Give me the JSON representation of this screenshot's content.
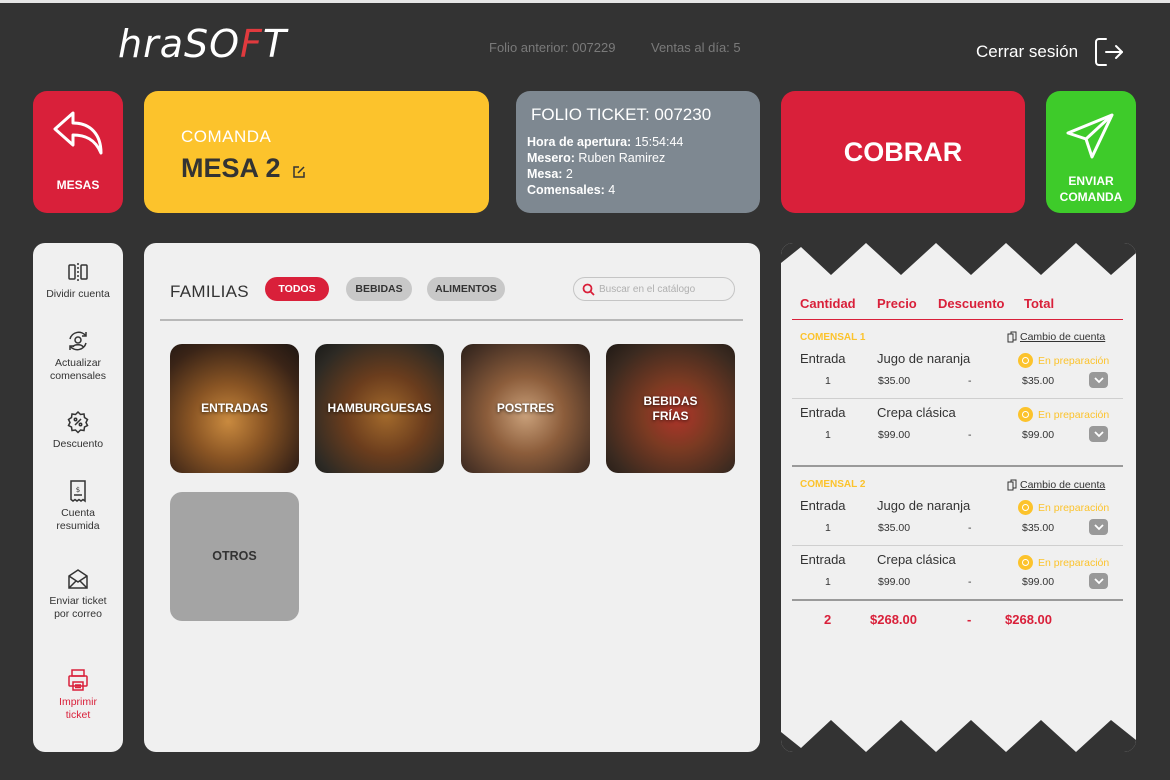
{
  "header": {
    "logo_prefix": "hraSO",
    "logo_accent": "F",
    "logo_suffix": "T",
    "folio_anterior": "Folio anterior: 007229",
    "ventas_dia": "Ventas al día: 5",
    "logout_label": "Cerrar sesión"
  },
  "cards": {
    "mesas_label": "MESAS",
    "comanda_caption": "COMANDA",
    "mesa_title": "MESA 2",
    "ticket": {
      "title": "FOLIO TICKET: 007230",
      "hora_label": "Hora de apertura:",
      "hora_value": "15:54:44",
      "mesero_label": "Mesero:",
      "mesero_value": "Ruben Ramirez",
      "mesa_label": "Mesa:",
      "mesa_value": "2",
      "comensales_label": "Comensales:",
      "comensales_value": "4"
    },
    "cobrar_label": "COBRAR",
    "enviar_line1": "ENVIAR",
    "enviar_line2": "COMANDA"
  },
  "tools": [
    {
      "label1": "Dividir cuenta",
      "label2": "",
      "icon": "split-icon"
    },
    {
      "label1": "Actualizar",
      "label2": "comensales",
      "icon": "refresh-user-icon"
    },
    {
      "label1": "Descuento",
      "label2": "",
      "icon": "discount-icon"
    },
    {
      "label1": "Cuenta",
      "label2": "resumida",
      "icon": "receipt-icon"
    },
    {
      "label1": "Enviar ticket",
      "label2": "por correo",
      "icon": "mail-icon"
    },
    {
      "label1": "Imprimir",
      "label2": "ticket",
      "icon": "printer-icon"
    }
  ],
  "catalog": {
    "title": "FAMILIAS",
    "chips": [
      "TODOS",
      "BEBIDAS",
      "ALIMENTOS"
    ],
    "search_placeholder": "Buscar en el catálogo",
    "tiles": [
      {
        "line1": "ENTRADAS",
        "line2": ""
      },
      {
        "line1": "HAMBURGUESAS",
        "line2": ""
      },
      {
        "line1": "POSTRES",
        "line2": ""
      },
      {
        "line1": "BEBIDAS",
        "line2": "FRÍAS"
      },
      {
        "line1": "OTROS",
        "line2": ""
      }
    ]
  },
  "receipt": {
    "columns": [
      "Cantidad",
      "Precio",
      "Descuento",
      "Total"
    ],
    "cambio_label": "Cambio de cuenta",
    "groups": [
      {
        "name": "COMENSAL 1",
        "items": [
          {
            "category": "Entrada",
            "name": "Jugo de naranja",
            "status": "En preparación",
            "qty": "1",
            "price": "$35.00",
            "discount": "-",
            "total": "$35.00"
          },
          {
            "category": "Entrada",
            "name": "Crepa clásica",
            "status": "En preparación",
            "qty": "1",
            "price": "$99.00",
            "discount": "-",
            "total": "$99.00"
          }
        ]
      },
      {
        "name": "COMENSAL 2",
        "items": [
          {
            "category": "Entrada",
            "name": "Jugo de naranja",
            "status": "En preparación",
            "qty": "1",
            "price": "$35.00",
            "discount": "-",
            "total": "$35.00"
          },
          {
            "category": "Entrada",
            "name": "Crepa clásica",
            "status": "En preparación",
            "qty": "1",
            "price": "$99.00",
            "discount": "-",
            "total": "$99.00"
          }
        ]
      }
    ],
    "totals": {
      "qty": "2",
      "price": "$268.00",
      "discount": "-",
      "total": "$268.00"
    }
  },
  "colors": {
    "background": "#333333",
    "red": "#d9203a",
    "yellow": "#fcc32c",
    "gray_card": "#7e8891",
    "green": "#3ecb2a",
    "panel": "#f0f0f0"
  }
}
